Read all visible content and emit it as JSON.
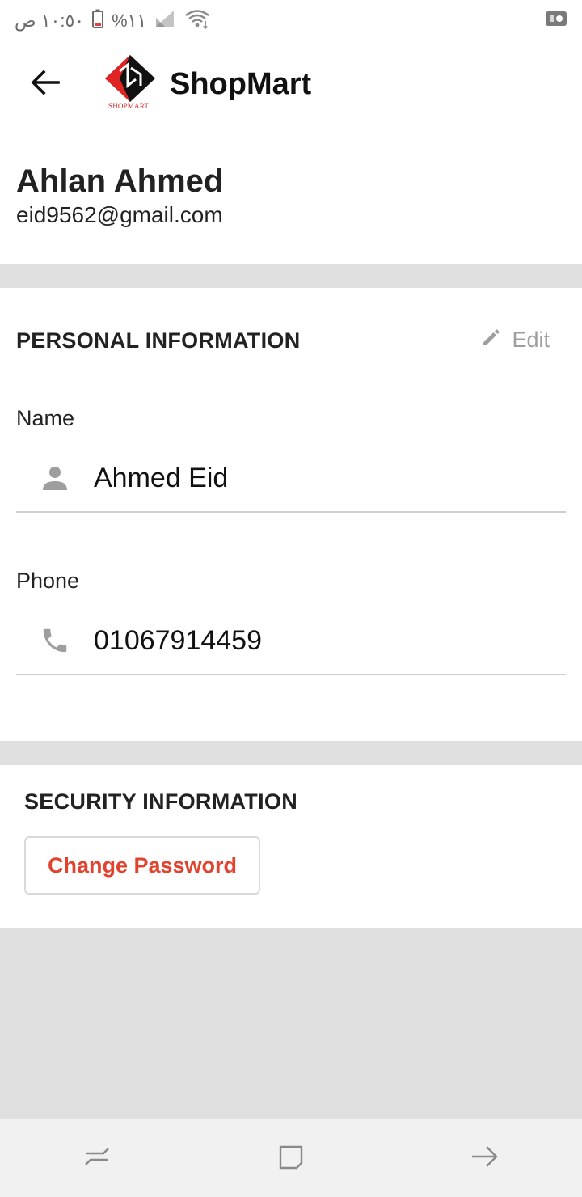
{
  "status_bar": {
    "time": "١٠:٥٠ ص",
    "battery": "%١١",
    "icons": [
      "signal-icon",
      "wifi-icon",
      "battery-icon",
      "video-record-icon"
    ]
  },
  "app_bar": {
    "title": "ShopMart",
    "logo_text": "SHOPMART",
    "back_icon": "arrow-left-icon"
  },
  "greeting": {
    "name": "Ahlan Ahmed",
    "email": "eid9562@gmail.com"
  },
  "personal": {
    "title": "PERSONAL INFORMATION",
    "edit_label": "Edit",
    "name_label": "Name",
    "name_value": "Ahmed Eid",
    "phone_label": "Phone",
    "phone_value": "01067914459"
  },
  "security": {
    "title": "SECURITY INFORMATION",
    "change_password_label": "Change Password"
  },
  "colors": {
    "accent": "#e0442f",
    "divider": "#e0e0e0",
    "muted": "#9e9e9e"
  }
}
